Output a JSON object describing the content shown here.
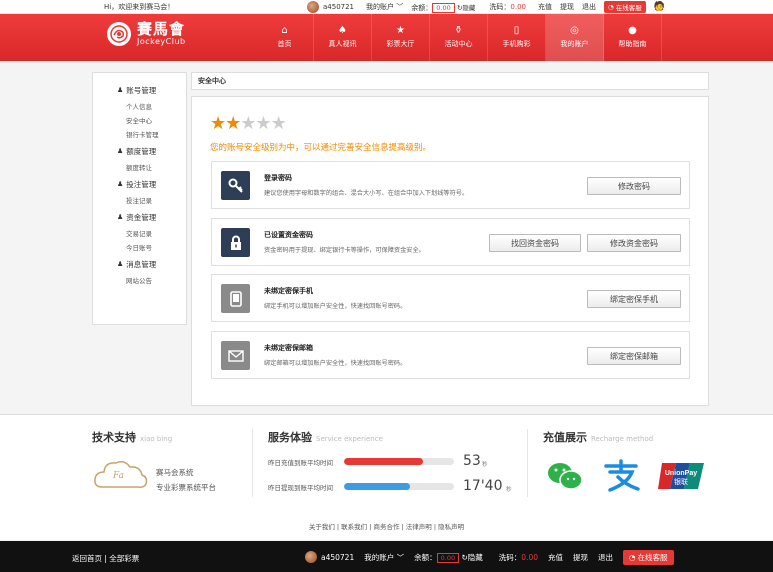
{
  "topbar": {
    "welcome": "Hi，欢迎来到赛马会！",
    "username": "a450721",
    "my_account": "我的账户",
    "balance_label": "余额：",
    "balance_value": "0.00",
    "hide_label": "隐藏",
    "wash_label": "洗码：",
    "wash_value": "0.00",
    "recharge": "充值",
    "withdraw": "提现",
    "logout": "退出",
    "online_service": "在线客服"
  },
  "header": {
    "logo_cn": "賽馬會",
    "logo_en": "JockeyClub",
    "nav": [
      {
        "label": "首页",
        "icon": "home-icon"
      },
      {
        "label": "真人视讯",
        "icon": "spade-icon"
      },
      {
        "label": "彩票大厅",
        "icon": "star-icon"
      },
      {
        "label": "活动中心",
        "icon": "gift-icon"
      },
      {
        "label": "手机购彩",
        "icon": "phone-icon"
      },
      {
        "label": "我的账户",
        "icon": "user-icon",
        "active": true
      },
      {
        "label": "帮助指南",
        "icon": "info-icon"
      }
    ]
  },
  "sidebar": {
    "groups": [
      {
        "title": "账号管理",
        "items": [
          "个人信息",
          "安全中心",
          "银行卡管理"
        ]
      },
      {
        "title": "额度管理",
        "items": [
          "额度转让"
        ]
      },
      {
        "title": "投注管理",
        "items": [
          "投注记录"
        ]
      },
      {
        "title": "资金管理",
        "items": [
          "交易记录",
          "今日账号"
        ]
      },
      {
        "title": "消息管理",
        "items": [
          "网站公告"
        ]
      }
    ]
  },
  "main": {
    "title": "安全中心",
    "security_level": 2,
    "security_max": 5,
    "security_message": "您的账号安全级别为中，可以通过完善安全信息提高级别。",
    "cards": [
      {
        "title": "登录密码",
        "desc": "建议您使用字母和数字的组合、混合大小写、在组合中加入下划线等符号。",
        "buttons": [
          "修改密码"
        ],
        "icon": "key-icon",
        "color": "#2e3e57"
      },
      {
        "title": "已设置资金密码",
        "desc": "资金密码用于提现、绑定银行卡等操作，可保障资金安全。",
        "buttons": [
          "找回资金密码",
          "修改资金密码"
        ],
        "icon": "lock-icon",
        "color": "#2e3e57"
      },
      {
        "title": "未绑定密保手机",
        "desc": "绑定手机可以增加账户安全性，快速找回账号密码。",
        "buttons": [
          "绑定密保手机"
        ],
        "icon": "mobile-icon",
        "color": "#8a8a8a"
      },
      {
        "title": "未绑定密保邮箱",
        "desc": "绑定邮箱可以增加账户安全性，快速找回账号密码。",
        "buttons": [
          "绑定密保邮箱"
        ],
        "icon": "mail-icon",
        "color": "#8a8a8a"
      }
    ]
  },
  "footer": {
    "tech": {
      "title": "技术支持",
      "title_en": "xiao bing",
      "line1": "赛马会系统",
      "line2": "专业彩票系统平台",
      "seal": "Fa"
    },
    "service": {
      "title": "服务体验",
      "title_en": "Service experience",
      "rows": [
        {
          "label": "昨日充值到账平均时间",
          "value": "53",
          "unit": "秒",
          "level": 0.72,
          "color": "#e53935"
        },
        {
          "label": "昨日提现到账平均时间",
          "value": "17'40",
          "unit": "秒",
          "level": 0.6,
          "color": "#3d9be0"
        }
      ]
    },
    "recharge": {
      "title": "充值展示",
      "title_en": "Recharge method",
      "methods": [
        "wechat-icon",
        "alipay-icon",
        "unionpay-icon"
      ]
    }
  },
  "bottom_links": "关于我们  |  联系我们  |  商务合作  |  法律声明  |  隐私声明",
  "bottom_bar": {
    "back_home": "返回首页",
    "all_lottery": "全部彩票",
    "username": "a450721",
    "my_account": "我的账户",
    "balance_label": "余额：",
    "balance_value": "0.00",
    "hide_label": "隐藏",
    "wash_label": "洗码：",
    "wash_value": "0.00",
    "recharge": "充值",
    "withdraw": "提现",
    "logout": "退出",
    "online_service": "在线客服"
  },
  "colors": {
    "brand_red": "#e53935",
    "accent_orange": "#f08a00",
    "dark_icon": "#2e3e57"
  }
}
